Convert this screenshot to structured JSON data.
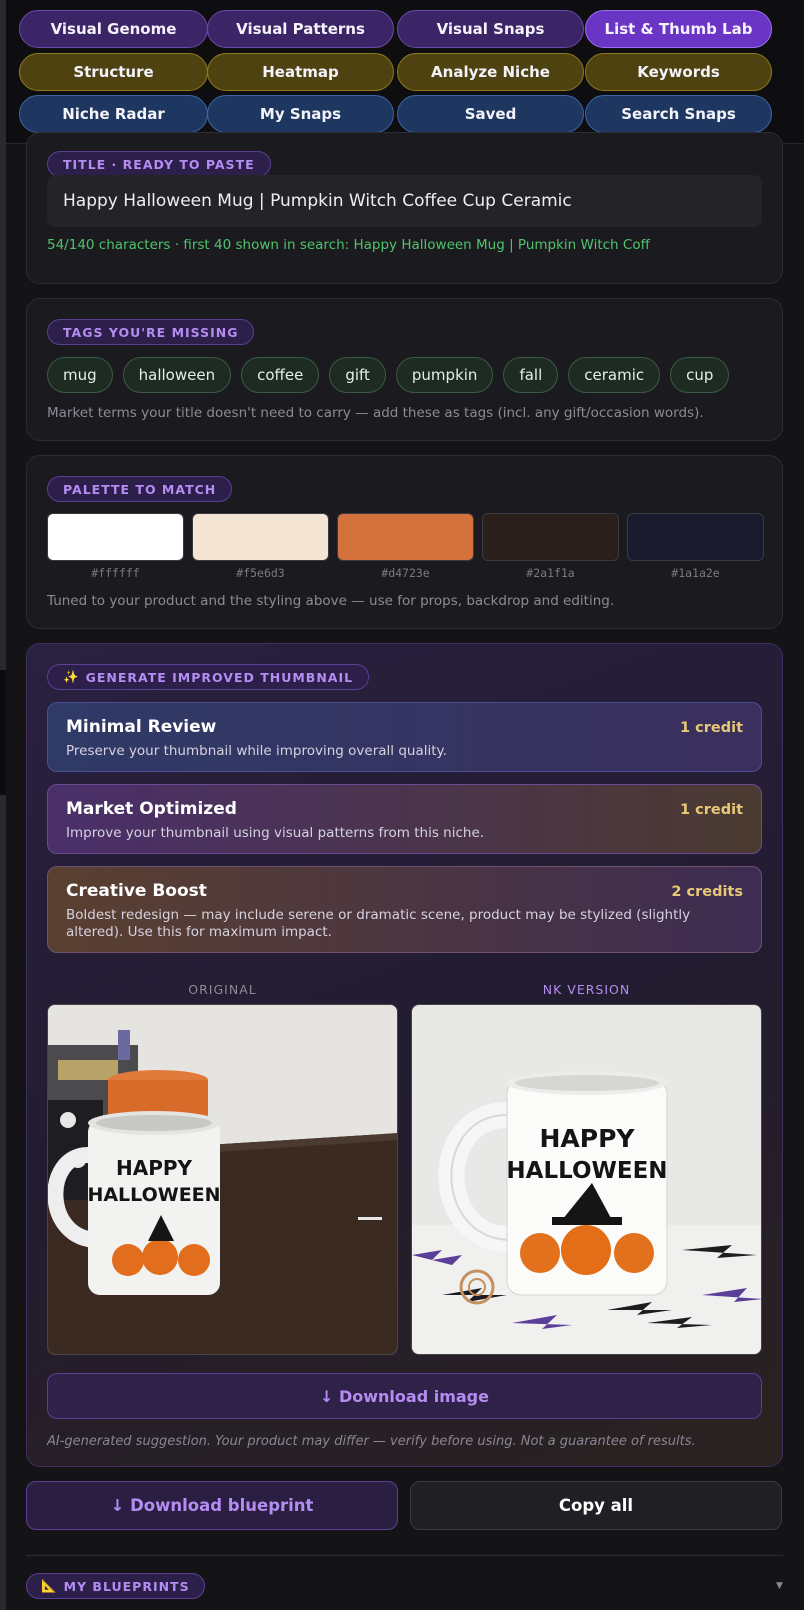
{
  "nav": {
    "row1": [
      "Visual Genome",
      "Visual Patterns",
      "Visual Snaps",
      "List & Thumb Lab"
    ],
    "row2": [
      "Structure",
      "Heatmap",
      "Analyze Niche",
      "Keywords"
    ],
    "row3": [
      "Niche Radar",
      "My Snaps",
      "Saved",
      "Search Snaps"
    ],
    "active": "List & Thumb Lab"
  },
  "title_card": {
    "label": "TITLE · READY TO PASTE",
    "value": "Happy Halloween Mug | Pumpkin Witch Coffee Cup Ceramic",
    "meta": "54/140 characters · first 40 shown in search: Happy Halloween Mug | Pumpkin Witch Coff"
  },
  "tags_card": {
    "label": "TAGS YOU'RE MISSING",
    "tags": [
      "mug",
      "halloween",
      "coffee",
      "gift",
      "pumpkin",
      "fall",
      "ceramic",
      "cup"
    ],
    "hint": "Market terms your title doesn't need to carry — add these as tags (incl. any gift/occasion words)."
  },
  "palette_card": {
    "label": "PALETTE TO MATCH",
    "colors": [
      "#ffffff",
      "#f5e6d3",
      "#d4723e",
      "#2a1f1a",
      "#1a1a2e"
    ],
    "hint": "Tuned to your product and the styling above — use for props, backdrop and editing."
  },
  "generate": {
    "label": "GENERATE IMPROVED THUMBNAIL",
    "label_icon": "✨",
    "options": [
      {
        "title": "Minimal Review",
        "credit": "1 credit",
        "desc": "Preserve your thumbnail while improving overall quality."
      },
      {
        "title": "Market Optimized",
        "credit": "1 credit",
        "desc": "Improve your thumbnail using visual patterns from this niche."
      },
      {
        "title": "Creative Boost",
        "credit": "2 credits",
        "desc": "Boldest redesign — may include serene or dramatic scene, product may be stylized (slightly altered). Use this for maximum impact."
      }
    ],
    "original_label": "ORIGINAL",
    "nk_label": "NK VERSION",
    "mug_text_line1": "HAPPY",
    "mug_text_line2": "HALLOWEEN",
    "download_image": "↓ Download image",
    "disclaimer": "AI-generated suggestion. Your product may differ — verify before using. Not a guarantee of results."
  },
  "actions": {
    "download_blueprint": "↓ Download blueprint",
    "copy_all": "Copy all"
  },
  "my_blueprints": {
    "icon": "📐",
    "label": "MY BLUEPRINTS",
    "chevron": "▼"
  }
}
